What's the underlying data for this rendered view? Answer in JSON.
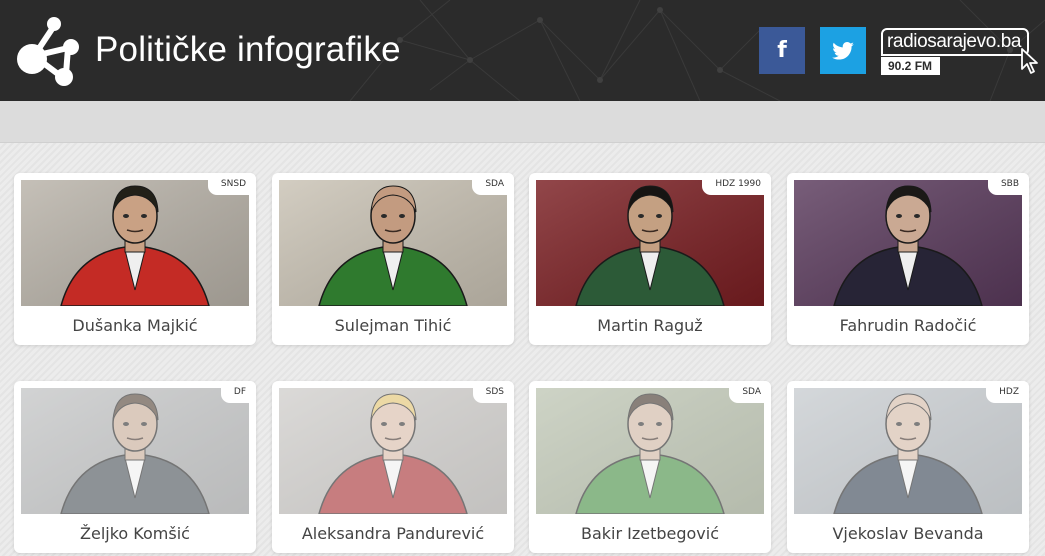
{
  "header": {
    "title": "Političke infografike",
    "facebook_glyph": "f",
    "twitter_icon": "twitter-bird-icon",
    "radio_logo": {
      "name": "radiosarajevo.ba",
      "frequency": "90.2 FM"
    }
  },
  "colors": {
    "header_bg": "#2b2b2b",
    "facebook": "#3b5998",
    "twitter": "#1ca1e3",
    "subbar": "#dcdcdc",
    "card_bg": "#ffffff"
  },
  "politicians": [
    {
      "name": "Dušanka Majkić",
      "party": "SNSD",
      "bg": "#b8b2a8",
      "suit": "#c42b25",
      "skin": "#c9a184",
      "hair": "#222018"
    },
    {
      "name": "Sulejman Tihić",
      "party": "SDA",
      "bg": "#c9c2b4",
      "suit": "#2f7a2e",
      "skin": "#c39b80",
      "hair": "#c39b80"
    },
    {
      "name": "Martin Raguž",
      "party": "HDZ 1990",
      "bg": "#7a1e22",
      "suit": "#2c5a37",
      "skin": "#c4a082",
      "hair": "#161412"
    },
    {
      "name": "Fahrudin Radočić",
      "party": "SBB",
      "bg": "#5a3a5c",
      "suit": "#272436",
      "skin": "#caa993",
      "hair": "#1b1917"
    },
    {
      "name": "Željko Komšić",
      "party": "DF",
      "bg": "#a5a7a8",
      "suit": "#424b52",
      "skin": "#c4a892",
      "hair": "#4d3c2e"
    },
    {
      "name": "Aleksandra Pandurević",
      "party": "SDS",
      "bg": "#b7b4b0",
      "suit": "#a2282b",
      "skin": "#d6b9a4",
      "hair": "#e1c06a"
    },
    {
      "name": "Bakir Izetbegović",
      "party": "SDA",
      "bg": "#9ca88c",
      "suit": "#3f8a3c",
      "skin": "#cdb19d",
      "hair": "#3b2c22"
    },
    {
      "name": "Vjekoslav Bevanda",
      "party": "HDZ",
      "bg": "#a9b0b6",
      "suit": "#2f3b4d",
      "skin": "#d2b6a2",
      "hair": "#d2b6a2"
    }
  ]
}
